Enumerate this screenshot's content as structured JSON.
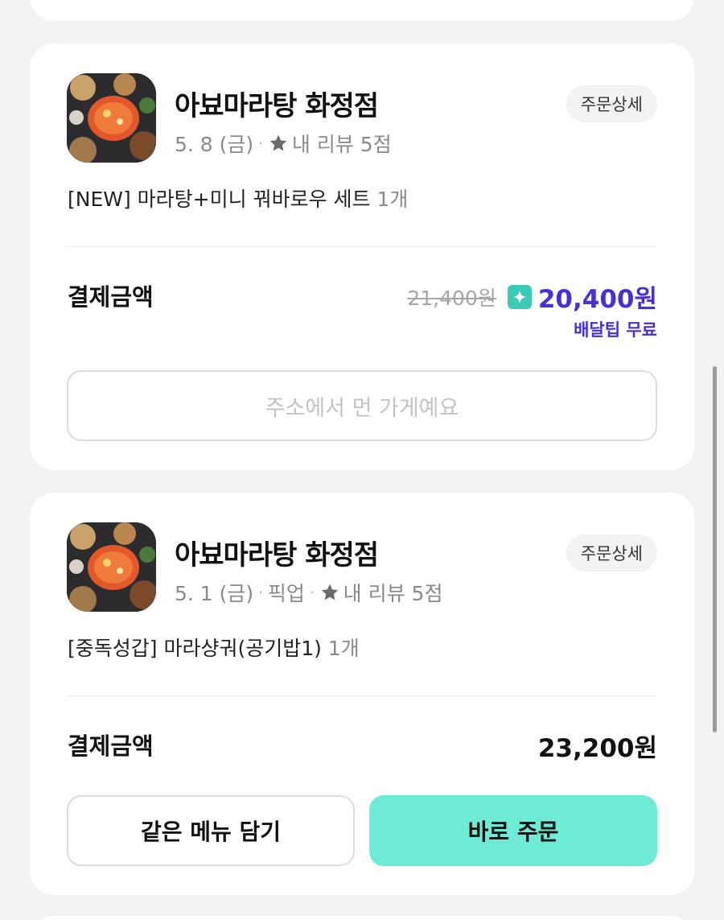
{
  "orders": [
    {
      "store_name": "아뵤마라탕 화정점",
      "date": "5. 8 (금)",
      "pickup_label": "",
      "review_label": "내 리뷰 5점",
      "detail_button": "주문상세",
      "menu": "[NEW] 마라탕+미니 꿔바로우 세트",
      "quantity": "1개",
      "payment_label": "결제금액",
      "original_price": "21,400원",
      "price": "20,400원",
      "delivery_tip": "배달팁 무료",
      "status_button": "주소에서 먼 가게예요"
    },
    {
      "store_name": "아뵤마라탕 화정점",
      "date": "5. 1 (금)",
      "pickup_label": "픽업",
      "review_label": "내 리뷰 5점",
      "detail_button": "주문상세",
      "menu": "[중독성갑] 마라샹궈(공기밥1)",
      "quantity": "1개",
      "payment_label": "결제금액",
      "price": "23,200원",
      "add_same_menu_button": "같은 메뉴 담기",
      "order_now_button": "바로 주문"
    }
  ],
  "colors": {
    "accent_purple": "#4b2fd6",
    "mint_button": "#6debd5",
    "mint_badge": "#3cc9b6"
  },
  "icons": {
    "star": "star-icon",
    "sparkle": "sparkle-icon"
  }
}
